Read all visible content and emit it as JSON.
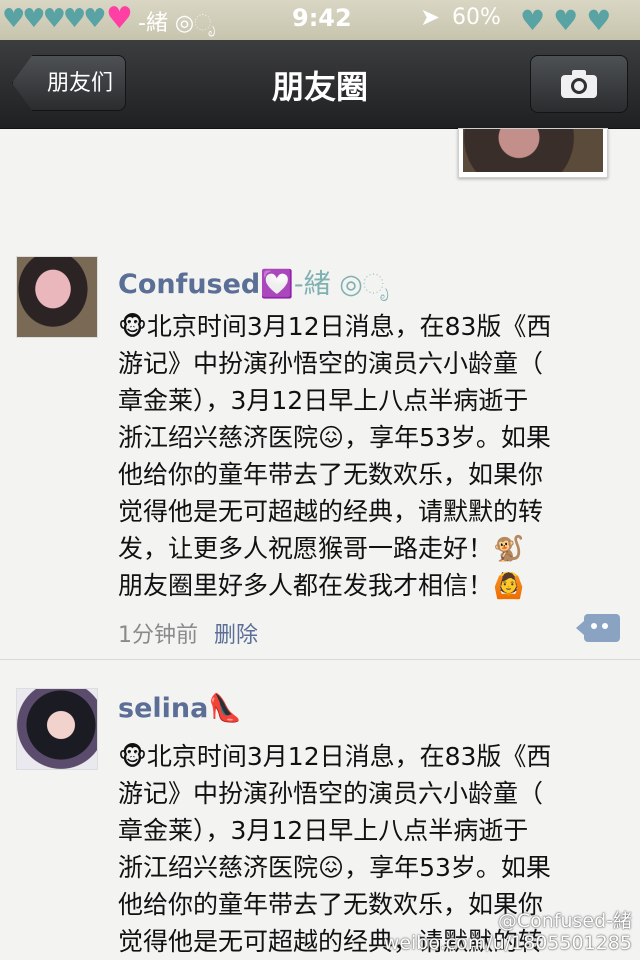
{
  "status_bar": {
    "hearts": "♥♥♥♥♥",
    "pink_heart": "♥",
    "name": "-緒 ◎ೃ",
    "time": "9:42",
    "battery": "60%",
    "right_icons": "♥♥♥"
  },
  "nav": {
    "back_label": "朋友们",
    "title": "朋友圈",
    "camera_icon": "camera-icon"
  },
  "posts": [
    {
      "author": "Confused",
      "author_suffix": "-緒 ◎ೃ",
      "emoji_heart": "💟",
      "lines": [
        "🐵北京时间3月12日消息，在83版《西",
        "游记》中扮演孙悟空的演员六小龄童（",
        "章金莱），3月12日早上八点半病逝于",
        "浙江绍兴慈济医院😖，享年53岁。如果",
        "他给你的童年带去了无数欢乐，如果你",
        "觉得他是无可超越的经典，请默默的转",
        "发，让更多人祝愿猴哥一路走好！🐒",
        "朋友圈里好多人都在发我才相信！🙆"
      ],
      "time": "1分钟前",
      "delete_label": "删除"
    },
    {
      "author": "selina",
      "author_emoji": "👠",
      "lines": [
        "🐵北京时间3月12日消息，在83版《西",
        "游记》中扮演孙悟空的演员六小龄童（",
        "章金莱），3月12日早上八点半病逝于",
        "浙江绍兴慈济医院😖，享年53岁。如果",
        "他给你的童年带去了无数欢乐，如果你",
        "觉得他是无可超越的经典，请默默的转"
      ]
    }
  ],
  "watermark": {
    "line1": "@Confused-緒",
    "line2": "weibo.com/u/1805501285"
  }
}
